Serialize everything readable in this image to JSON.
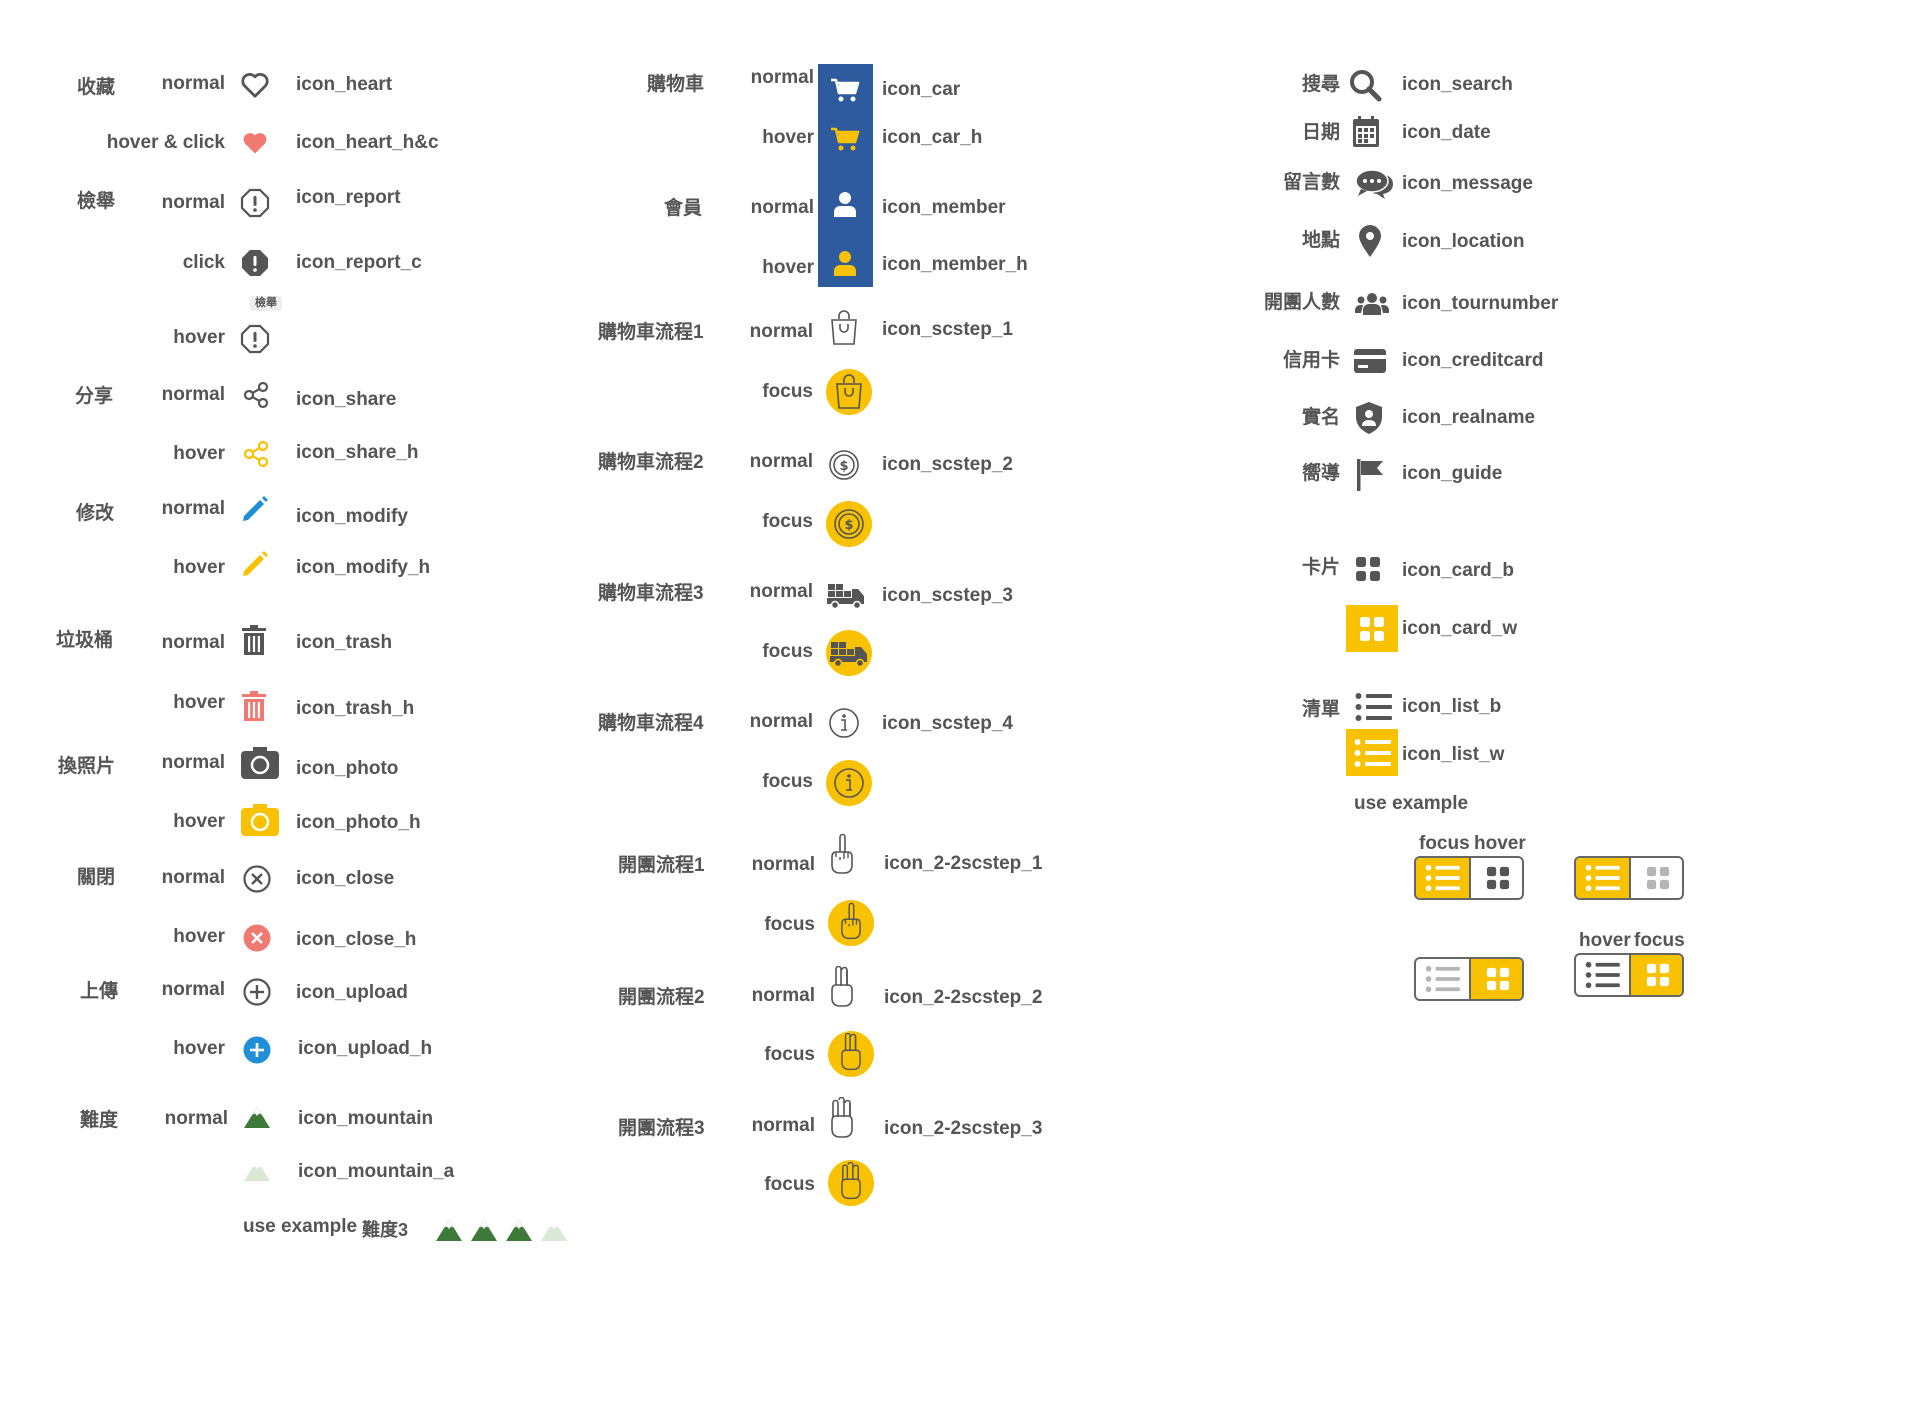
{
  "colors": {
    "gray": "#555555",
    "yellow": "#f9c200",
    "coral": "#f07a72",
    "blue": "#1f8fd6",
    "navy": "#2d5b9e",
    "green": "#3d7a3a",
    "palegreen": "#d9e9d5"
  },
  "col1": {
    "favorite": {
      "category": "收藏",
      "normal_state": "normal",
      "normal_name": "icon_heart",
      "hover_state": "hover & click",
      "hover_name": "icon_heart_h&c"
    },
    "report": {
      "category": "檢舉",
      "normal_state": "normal",
      "normal_name": "icon_report",
      "click_state": "click",
      "click_name": "icon_report_c",
      "tooltip": "檢舉",
      "hover_state": "hover"
    },
    "share": {
      "category": "分享",
      "normal_state": "normal",
      "normal_name": "icon_share",
      "hover_state": "hover",
      "hover_name": "icon_share_h"
    },
    "modify": {
      "category": "修改",
      "normal_state": "normal",
      "normal_name": "icon_modify",
      "hover_state": "hover",
      "hover_name": "icon_modify_h"
    },
    "trash": {
      "category": "垃圾桶",
      "normal_state": "normal",
      "normal_name": "icon_trash",
      "hover_state": "hover",
      "hover_name": "icon_trash_h"
    },
    "photo": {
      "category": "換照片",
      "normal_state": "normal",
      "normal_name": "icon_photo",
      "hover_state": "hover",
      "hover_name": "icon_photo_h"
    },
    "close": {
      "category": "關閉",
      "normal_state": "normal",
      "normal_name": "icon_close",
      "hover_state": "hover",
      "hover_name": "icon_close_h"
    },
    "upload": {
      "category": "上傳",
      "normal_state": "normal",
      "normal_name": "icon_upload",
      "hover_state": "hover",
      "hover_name": "icon_upload_h"
    },
    "difficulty": {
      "category": "難度",
      "normal_state": "normal",
      "normal_name": "icon_mountain",
      "alt_name": "icon_mountain_a",
      "example_label": "use example",
      "example_text": "難度3",
      "example_level": 3,
      "example_max": 4
    }
  },
  "col2": {
    "cart": {
      "category": "購物車",
      "normal_state": "normal",
      "normal_name": "icon_car",
      "hover_state": "hover",
      "hover_name": "icon_car_h"
    },
    "member": {
      "category": "會員",
      "normal_state": "normal",
      "normal_name": "icon_member",
      "hover_state": "hover",
      "hover_name": "icon_member_h"
    },
    "scstep1": {
      "category": "購物車流程1",
      "normal_state": "normal",
      "normal_name": "icon_scstep_1",
      "focus_state": "focus"
    },
    "scstep2": {
      "category": "購物車流程2",
      "normal_state": "normal",
      "normal_name": "icon_scstep_2",
      "focus_state": "focus"
    },
    "scstep3": {
      "category": "購物車流程3",
      "normal_state": "normal",
      "normal_name": "icon_scstep_3",
      "focus_state": "focus"
    },
    "scstep4": {
      "category": "購物車流程4",
      "normal_state": "normal",
      "normal_name": "icon_scstep_4",
      "focus_state": "focus"
    },
    "group1": {
      "category": "開團流程1",
      "normal_state": "normal",
      "normal_name": "icon_2-2scstep_1",
      "focus_state": "focus"
    },
    "group2": {
      "category": "開團流程2",
      "normal_state": "normal",
      "normal_name": "icon_2-2scstep_2",
      "focus_state": "focus"
    },
    "group3": {
      "category": "開團流程3",
      "normal_state": "normal",
      "normal_name": "icon_2-2scstep_3",
      "focus_state": "focus"
    }
  },
  "col3": {
    "search": {
      "category": "搜尋",
      "name": "icon_search"
    },
    "date": {
      "category": "日期",
      "name": "icon_date"
    },
    "message": {
      "category": "留言數",
      "name": "icon_message"
    },
    "location": {
      "category": "地點",
      "name": "icon_location"
    },
    "tournumber": {
      "category": "開團人數",
      "name": "icon_tournumber"
    },
    "creditcard": {
      "category": "信用卡",
      "name": "icon_creditcard"
    },
    "realname": {
      "category": "實名",
      "name": "icon_realname"
    },
    "guide": {
      "category": "嚮導",
      "name": "icon_guide"
    },
    "card": {
      "category": "卡片",
      "name_b": "icon_card_b",
      "name_w": "icon_card_w"
    },
    "list": {
      "category": "清單",
      "name_b": "icon_list_b",
      "name_w": "icon_list_w"
    },
    "example": {
      "label": "use example",
      "focus": "focus",
      "hover": "hover"
    }
  }
}
